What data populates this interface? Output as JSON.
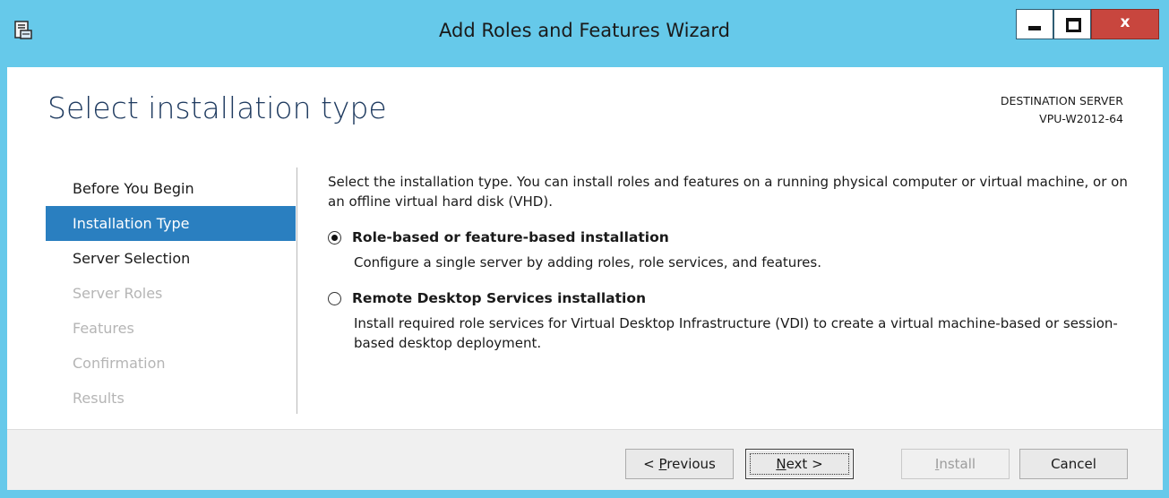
{
  "window": {
    "title": "Add Roles and Features Wizard",
    "icon": "server-manager-icon",
    "controls": {
      "minimize": "minimize-icon",
      "maximize": "maximize-icon",
      "close_glyph": "x"
    }
  },
  "header": {
    "page_title": "Select installation type",
    "destination_label": "DESTINATION SERVER",
    "destination_name": "VPU-W2012-64"
  },
  "nav": {
    "items": [
      {
        "label": "Before You Begin",
        "state": "normal"
      },
      {
        "label": "Installation Type",
        "state": "selected"
      },
      {
        "label": "Server Selection",
        "state": "normal"
      },
      {
        "label": "Server Roles",
        "state": "disabled"
      },
      {
        "label": "Features",
        "state": "disabled"
      },
      {
        "label": "Confirmation",
        "state": "disabled"
      },
      {
        "label": "Results",
        "state": "disabled"
      }
    ]
  },
  "main": {
    "intro": "Select the installation type. You can install roles and features on a running physical computer or virtual machine, or on an offline virtual hard disk (VHD).",
    "options": [
      {
        "title": "Role-based or feature-based installation",
        "description": "Configure a single server by adding roles, role services, and features.",
        "selected": true
      },
      {
        "title": "Remote Desktop Services installation",
        "description": "Install required role services for Virtual Desktop Infrastructure (VDI) to create a virtual machine-based or session-based desktop deployment.",
        "selected": false
      }
    ]
  },
  "footer": {
    "previous_prefix": "< ",
    "previous_access": "P",
    "previous_rest": "revious",
    "next_access": "N",
    "next_rest": "ext >",
    "install_access": "I",
    "install_rest": "nstall",
    "cancel_label": "Cancel"
  },
  "colors": {
    "titlebar": "#66c9ea",
    "nav_selected": "#2a7fc0",
    "close_button": "#c8463e",
    "footer": "#f0f0f0",
    "page_title": "#1e3a5f"
  }
}
